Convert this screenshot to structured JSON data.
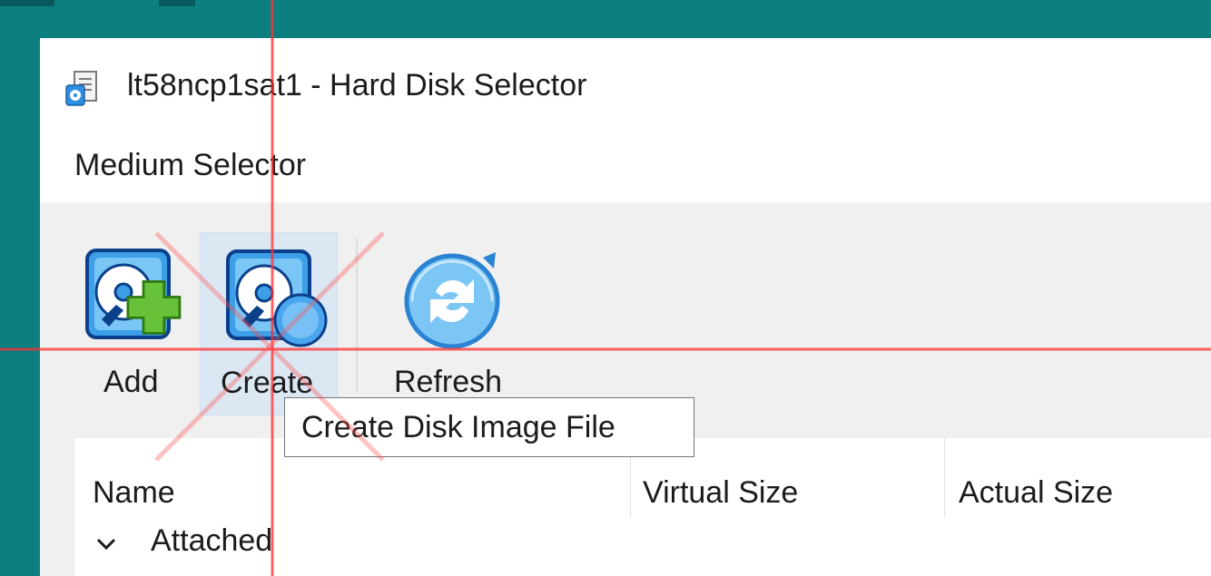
{
  "window": {
    "title": "lt58ncp1sat1 - Hard Disk Selector",
    "subtitle": "Medium Selector"
  },
  "toolbar": {
    "add_label": "Add",
    "create_label": "Create",
    "refresh_label": "Refresh"
  },
  "tooltip": {
    "text": "Create Disk Image File"
  },
  "table": {
    "columns": [
      "Name",
      "Virtual Size",
      "Actual Size"
    ],
    "groups": [
      {
        "label": "Attached",
        "expanded": true
      }
    ]
  },
  "icons": {
    "app": "hard-disk-app-icon",
    "add": "hard-disk-add-icon",
    "create": "hard-disk-create-icon",
    "refresh": "refresh-icon",
    "group_toggle": "chevron-down-icon"
  },
  "colors": {
    "desktop": "#0d7f81",
    "toolbar_bg": "#f0f0f0",
    "hover_bg": "#dbe8f4",
    "overlay_marker": "#ff0000"
  }
}
